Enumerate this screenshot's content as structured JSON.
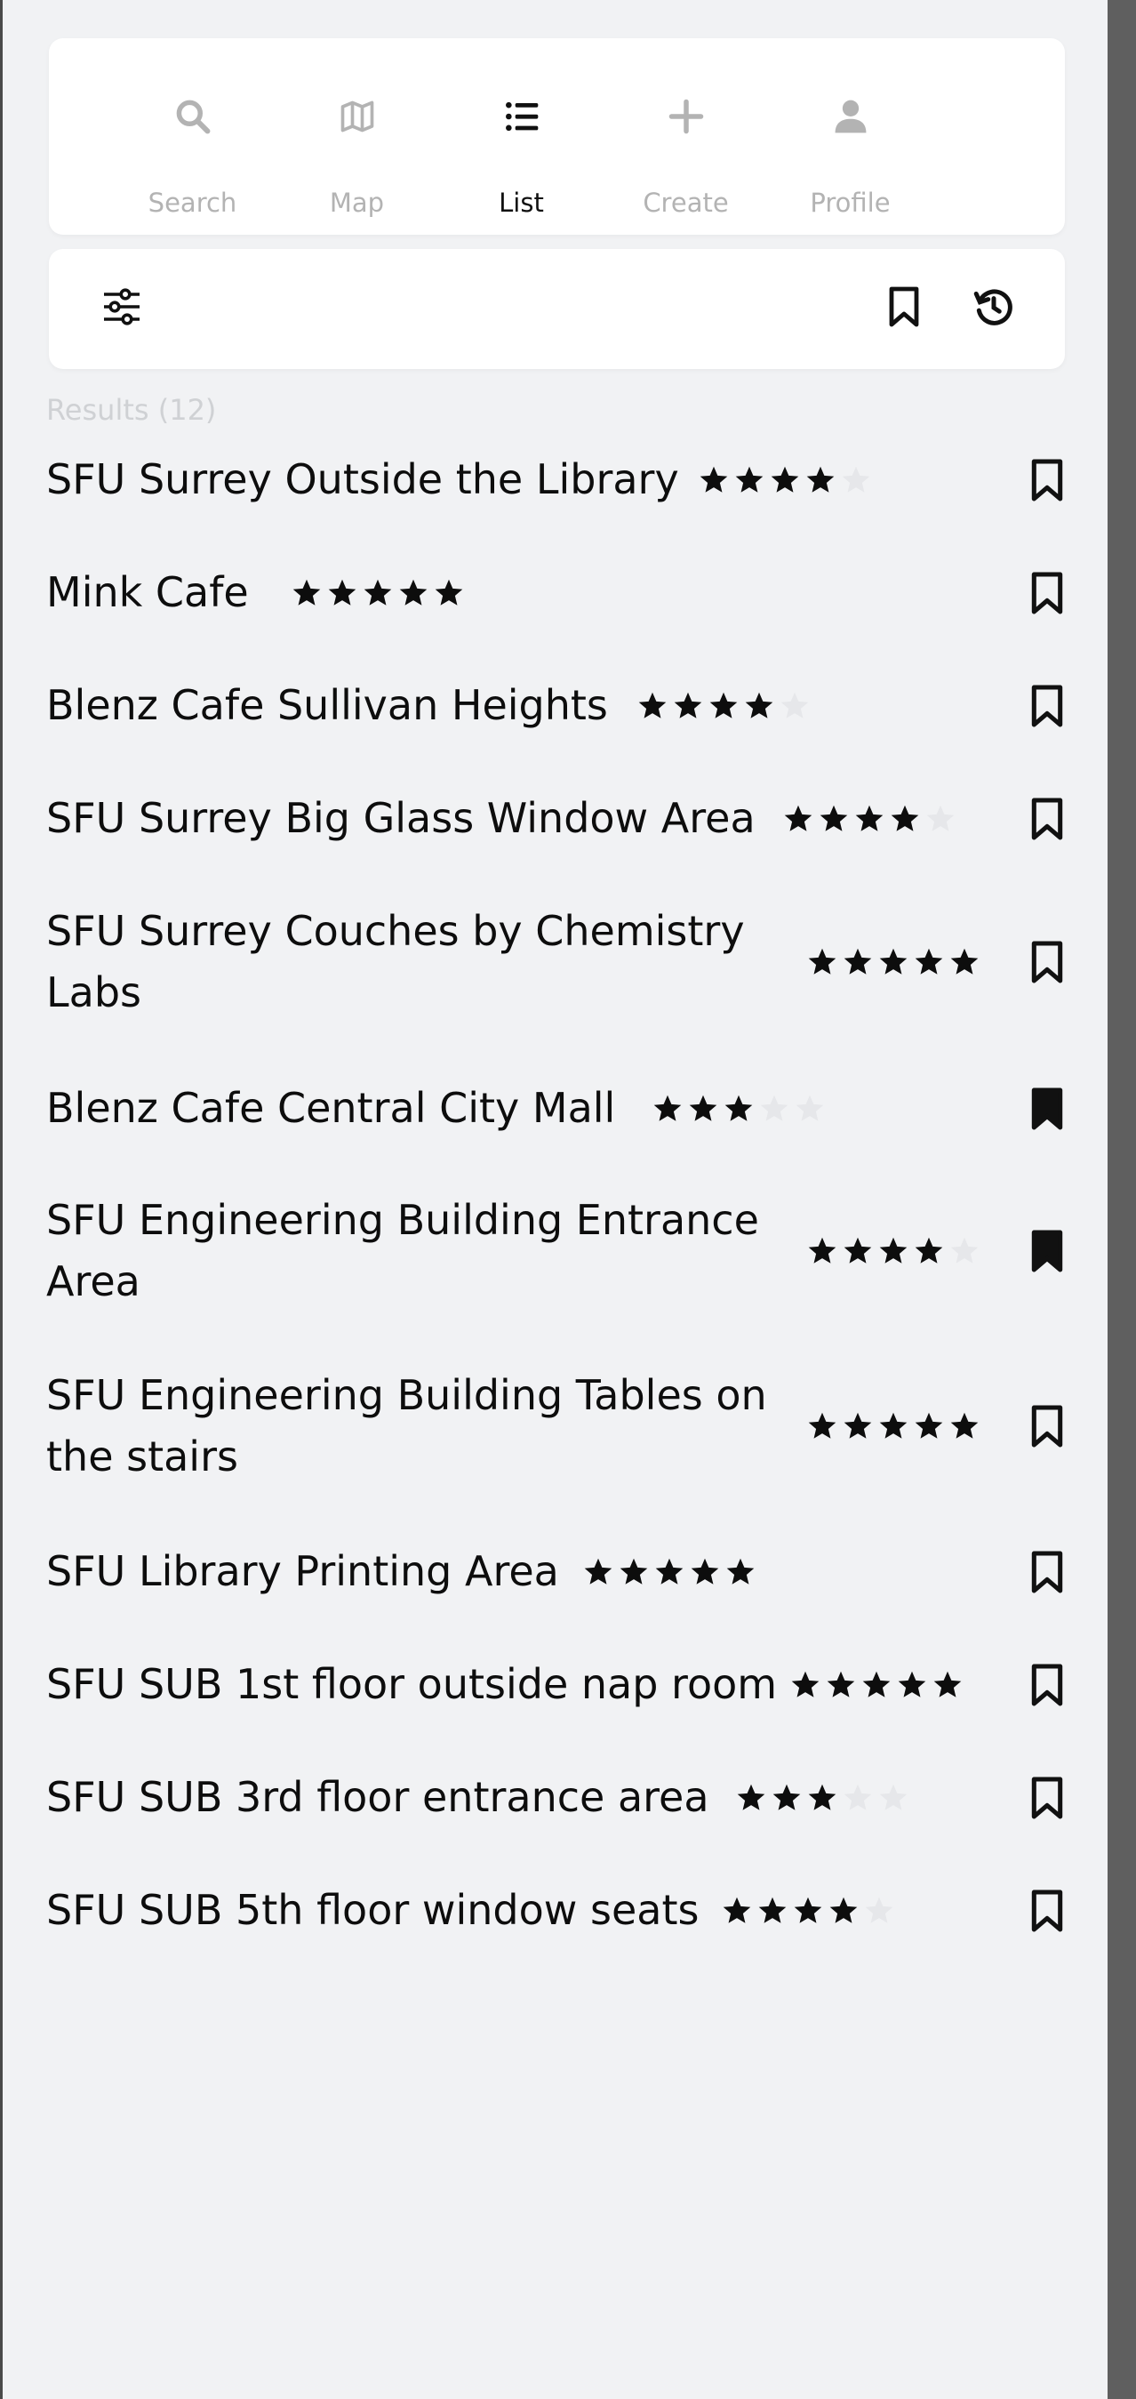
{
  "nav": {
    "items": [
      {
        "label": "Search",
        "icon": "search-icon",
        "active": false
      },
      {
        "label": "Map",
        "icon": "map-icon",
        "active": false
      },
      {
        "label": "List",
        "icon": "list-icon",
        "active": true
      },
      {
        "label": "Create",
        "icon": "plus-icon",
        "active": false
      },
      {
        "label": "Profile",
        "icon": "profile-icon",
        "active": false
      }
    ]
  },
  "toolbar": {
    "filter_icon": "sliders-icon",
    "bookmarks_icon": "bookmark-icon",
    "history_icon": "history-icon"
  },
  "results": {
    "label": "Results (12)",
    "items": [
      {
        "name": "SFU Surrey Outside the Library",
        "rating": 4,
        "saved": false
      },
      {
        "name": "Mink Cafe",
        "rating": 5,
        "saved": false
      },
      {
        "name": "Blenz Cafe Sullivan Heights",
        "rating": 4,
        "saved": false
      },
      {
        "name": "SFU Surrey Big Glass Window Area",
        "rating": 4,
        "saved": false
      },
      {
        "name": "SFU Surrey Couches by Chemistry Labs",
        "rating": 5,
        "saved": false
      },
      {
        "name": "Blenz Cafe Central City Mall",
        "rating": 3,
        "saved": true
      },
      {
        "name": "SFU Engineering Building Entrance Area",
        "rating": 4,
        "saved": true
      },
      {
        "name": "SFU Engineering Building Tables on the stairs",
        "rating": 5,
        "saved": false
      },
      {
        "name": "SFU Library Printing Area",
        "rating": 5,
        "saved": false
      },
      {
        "name": "SFU SUB 1st floor outside nap room",
        "rating": 5,
        "saved": false
      },
      {
        "name": "SFU SUB 3rd floor entrance area",
        "rating": 3,
        "saved": false
      },
      {
        "name": "SFU SUB 5th floor window seats",
        "rating": 4,
        "saved": false
      }
    ]
  },
  "colors": {
    "background": "#f1f2f4",
    "card": "#ffffff",
    "text": "#0d0d0d",
    "muted": "#b3b3b3",
    "star_filled": "#0d0d0d",
    "star_empty": "#e6e7ea"
  }
}
